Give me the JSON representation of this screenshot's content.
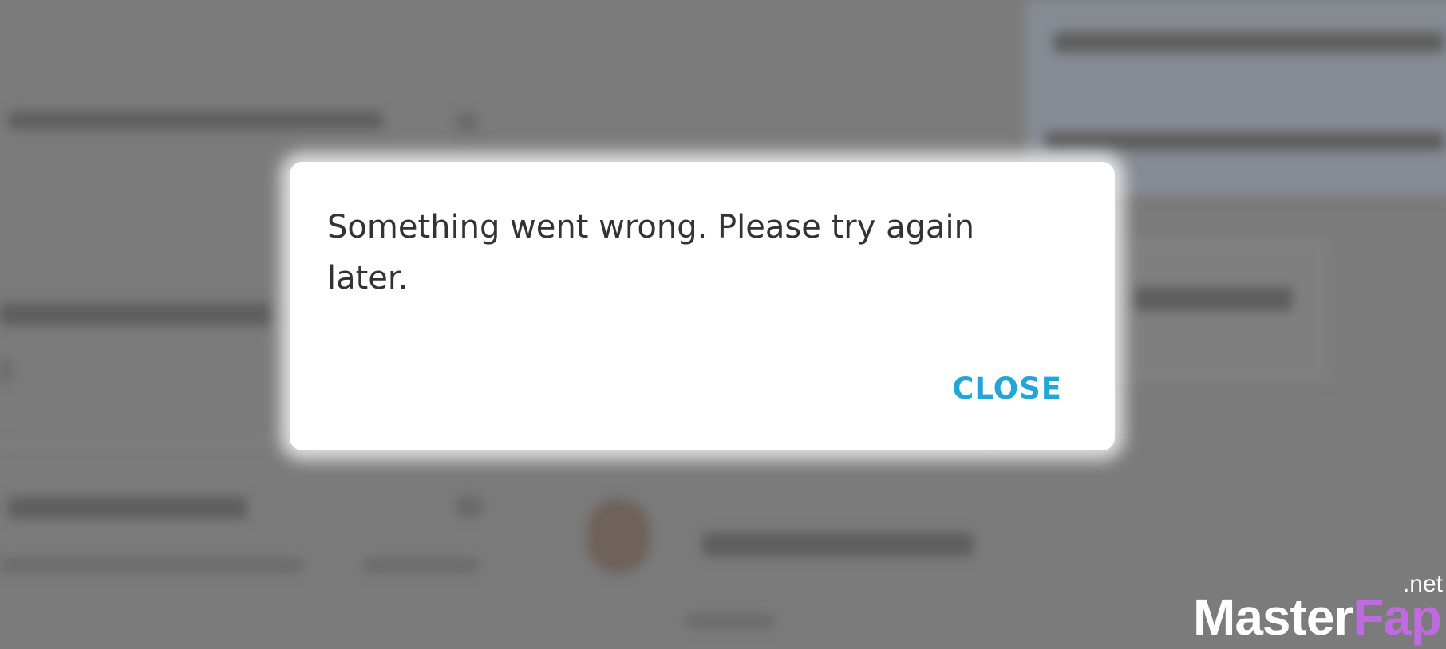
{
  "dialog": {
    "message": "Something went wrong. Please try again later.",
    "close_label": "CLOSE",
    "accent_color": "#22a6d8"
  },
  "watermark": {
    "text_main": "Master",
    "text_accent": "Fap",
    "text_suffix": ".net"
  },
  "colors": {
    "overlay": "#7b7b7b",
    "dialog_bg": "#ffffff",
    "message_text": "#333333"
  }
}
